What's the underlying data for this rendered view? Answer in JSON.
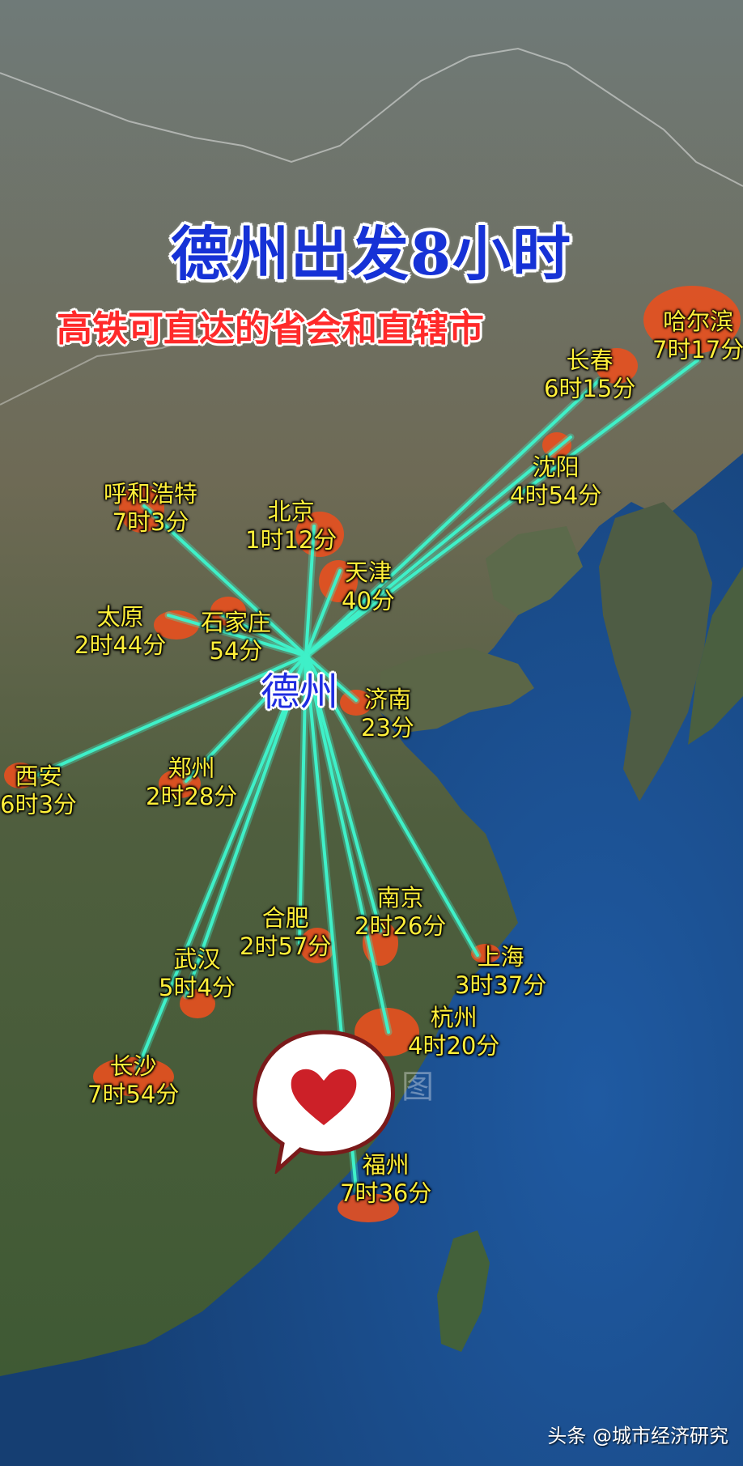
{
  "title": "德州出发8小时",
  "subtitle": "高铁可直达的省会和直辖市",
  "origin": "德州",
  "colors": {
    "route": "#3ff0c8",
    "city_fill": "#e8501f",
    "label": "#ffef3a",
    "title": "#1632d6",
    "subtitle": "#ff2a2a",
    "sea": "#1d4f8a",
    "land": "#5b6a4a"
  },
  "cities": [
    {
      "name": "哈尔滨",
      "time": "7时17分"
    },
    {
      "name": "长春",
      "time": "6时15分"
    },
    {
      "name": "沈阳",
      "time": "4时54分"
    },
    {
      "name": "呼和浩特",
      "time": "7时3分"
    },
    {
      "name": "北京",
      "time": "1时12分"
    },
    {
      "name": "天津",
      "time": "40分"
    },
    {
      "name": "太原",
      "time": "2时44分"
    },
    {
      "name": "石家庄",
      "time": "54分"
    },
    {
      "name": "济南",
      "time": "23分"
    },
    {
      "name": "西安",
      "time": "6时3分"
    },
    {
      "name": "郑州",
      "time": "2时28分"
    },
    {
      "name": "南京",
      "time": "2时26分"
    },
    {
      "name": "合肥",
      "time": "2时57分"
    },
    {
      "name": "武汉",
      "time": "5时4分"
    },
    {
      "name": "上海",
      "time": "3时37分"
    },
    {
      "name": "杭州",
      "time": "4时20分"
    },
    {
      "name": "长沙",
      "time": "7时54分"
    },
    {
      "name": "福州",
      "time": "7时36分"
    }
  ],
  "icons": {
    "bubble": "heart-speech-bubble-icon"
  },
  "watermark": "图",
  "footer": "头条 @城市经济研究"
}
